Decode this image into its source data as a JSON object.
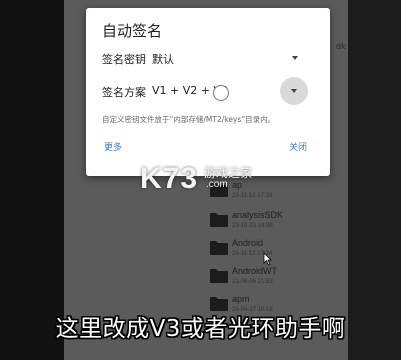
{
  "background": {
    "partial_text": "dk",
    "files": [
      {
        "name": "ap",
        "date": "23-11-12 17:33"
      },
      {
        "name": "analysisSDK",
        "date": "23-10-23 14:38"
      },
      {
        "name": "Android",
        "date": "23-11-12 17:34"
      },
      {
        "name": "AndroidWT",
        "date": "21-06-06 21:53"
      },
      {
        "name": "apm",
        "date": "23-04-17 10:18"
      }
    ]
  },
  "dialog": {
    "title": "自动签名",
    "key_label": "签名密钥",
    "key_value": "默认",
    "scheme_label": "签名方案",
    "scheme_value": "V1 + V2 + V3",
    "hint": "自定义密钥文件放于“内部存储/MT2/keys”目录内。",
    "more": "更多",
    "close": "关闭"
  },
  "watermark": {
    "logo": "K73",
    "cn": "游戏之家",
    "url": ".com"
  },
  "subtitle": "这里改成V3或者光环助手啊"
}
